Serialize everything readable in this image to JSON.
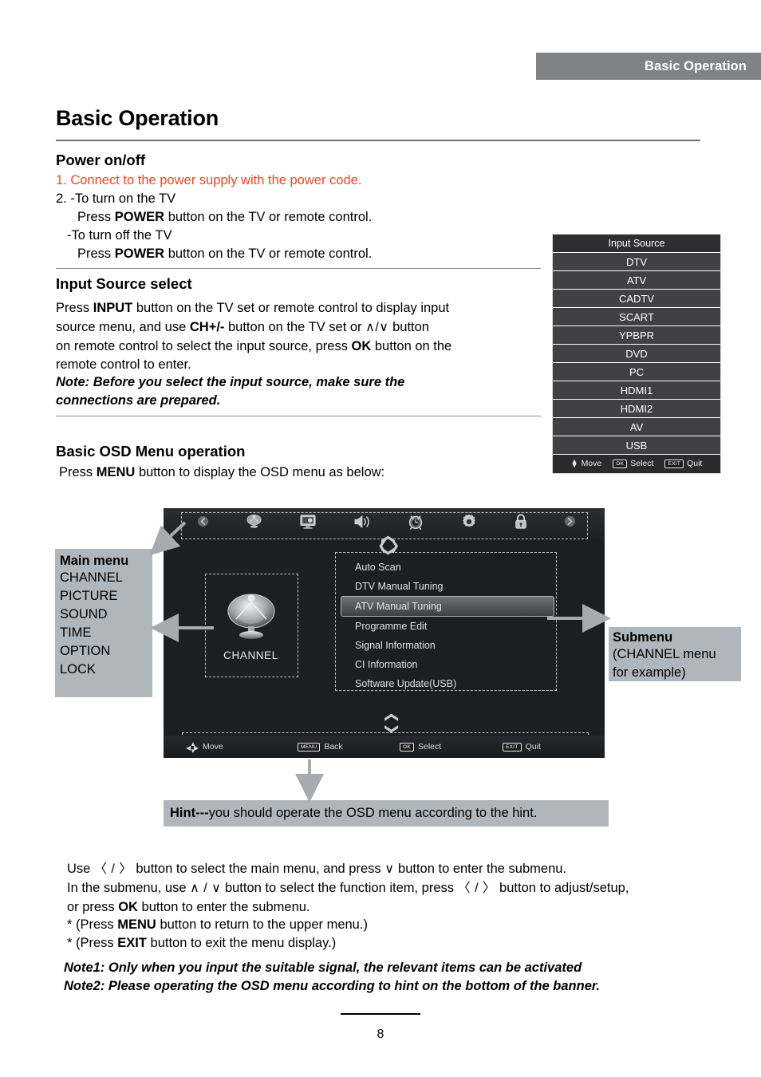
{
  "header": {
    "running_title": "Basic Operation"
  },
  "chapter": {
    "title": "Basic Operation"
  },
  "power": {
    "heading": "Power on/off",
    "line1": "1. Connect to the power supply with the power code.",
    "line2": "2. -To turn on the TV",
    "line3_pre": "Press ",
    "line3_bold": "POWER",
    "line3_post": " button on the TV or remote control.",
    "line4": "-To turn off the TV",
    "line5_pre": "Press ",
    "line5_bold": "POWER",
    "line5_post": " button on the TV or remote control."
  },
  "input_source": {
    "heading": "Input Source select",
    "p1_a": "Press ",
    "p1_b": "INPUT",
    "p1_c": " button on the TV set or remote control to display input",
    "p2_a": "source menu, and use ",
    "p2_b": "CH+/-",
    "p2_c": " button on the TV set or ",
    "p2_glyph": "∧/∨",
    "p2_d": "  button",
    "p3_a": "on remote control to select the input source, press ",
    "p3_b": "OK",
    "p3_c": " button on the",
    "p4": "remote control to enter.",
    "note1": "Note: Before you select the input source, make sure the",
    "note2": "connections are prepared."
  },
  "input_source_menu": {
    "title": "Input Source",
    "items": [
      "DTV",
      "ATV",
      "CADTV",
      "SCART",
      "YPBPR",
      "DVD",
      "PC",
      "HDMI1",
      "HDMI2",
      "AV",
      "USB"
    ],
    "footer": [
      {
        "key": "updown",
        "label": "Move"
      },
      {
        "key": "OK",
        "label": "Select"
      },
      {
        "key": "EXIT",
        "label": "Quit"
      }
    ]
  },
  "osd_section": {
    "heading": "Basic OSD Menu operation",
    "intro_a": "Press ",
    "intro_b": "MENU",
    "intro_c": " button to display the OSD menu as below:"
  },
  "osd": {
    "top_icons": [
      {
        "name": "chevron-left-icon",
        "glyph": "◂"
      },
      {
        "name": "satellite-dish-icon",
        "glyph": "◉"
      },
      {
        "name": "picture-monitor-icon",
        "glyph": "▣"
      },
      {
        "name": "speaker-sound-icon",
        "glyph": "◀"
      },
      {
        "name": "alarm-clock-time-icon",
        "glyph": "○"
      },
      {
        "name": "gear-option-icon",
        "glyph": "⚙"
      },
      {
        "name": "lock-icon",
        "glyph": "▬"
      },
      {
        "name": "chevron-right-icon",
        "glyph": "▸"
      }
    ],
    "main_tile_label": "CHANNEL",
    "submenu_items": [
      "Auto Scan",
      "DTV Manual Tuning",
      "ATV Manual Tuning",
      "Programme Edit",
      "Signal Information",
      "CI Information",
      "Software Update(USB)"
    ],
    "selected_index": 2,
    "bottom_bar": [
      {
        "key": "dpad",
        "label": "Move"
      },
      {
        "key": "MENU",
        "label": "Back"
      },
      {
        "key": "OK",
        "label": "Select"
      },
      {
        "key": "EXIT",
        "label": "Quit"
      }
    ]
  },
  "callouts": {
    "main_menu": {
      "title": "Main menu",
      "items": [
        "CHANNEL",
        "PICTURE",
        "SOUND",
        "TIME",
        "OPTION",
        "LOCK"
      ]
    },
    "submenu": {
      "title": "Submenu",
      "line1": "(CHANNEL menu",
      "line2": "for example)"
    },
    "hint": {
      "bold": "Hint---",
      "rest": "you should operate the OSD menu according to the hint."
    }
  },
  "instructions": {
    "l1_a": "Use ",
    "l1_g1": "〈 / 〉",
    "l1_b": " button to select the main menu, and press ",
    "l1_g2": "∨",
    "l1_c": " button to enter the submenu.",
    "l2_a": "In the submenu, use ",
    "l2_g1": "∧ / ∨",
    "l2_b": "  button to select the function item, press ",
    "l2_g2": "〈 / 〉",
    "l2_c": " button to adjust/setup,",
    "l3_a": "or press ",
    "l3_b": "OK",
    "l3_c": " button to enter the submenu.",
    "l4_a": "* (Press ",
    "l4_b": "MENU",
    "l4_c": " button to return to the upper menu.)",
    "l5_a": "* (Press ",
    "l5_b": "EXIT",
    "l5_c": " button to exit the menu display.)",
    "note1": "Note1: Only when you input the suitable signal, the relevant items can be activated",
    "note2": "Note2: Please operating the OSD menu according to hint on the bottom of the banner."
  },
  "footer": {
    "page_number": "8"
  },
  "colors": {
    "header_bar": "#808285",
    "accent_red": "#ef4823",
    "callout_gray": "#b0b7bc",
    "osd_bg": "#1c1e21"
  }
}
